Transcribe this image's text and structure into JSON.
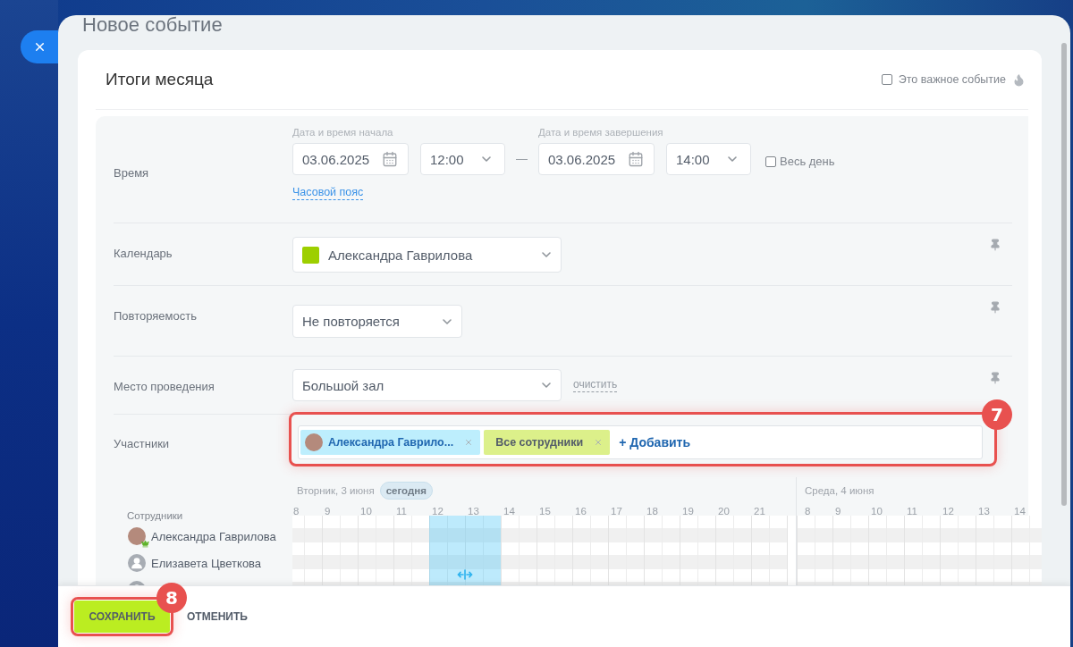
{
  "slider": {
    "title": "Новое событие"
  },
  "event": {
    "name": "Итоги месяца",
    "important": {
      "label": "Это важное событие",
      "checked": false
    }
  },
  "time": {
    "label": "Время",
    "start": {
      "caption": "Дата и время начала",
      "date": "03.06.2025",
      "time": "12:00"
    },
    "separator": "—",
    "end": {
      "caption": "Дата и время завершения",
      "date": "03.06.2025",
      "time": "14:00"
    },
    "all_day": {
      "label": "Весь день",
      "checked": false
    },
    "timezone_link": "Часовой пояс"
  },
  "fields": [
    {
      "kind": "calendar",
      "label": "Календарь",
      "value": "Александра Гаврилова",
      "color": "#9dcf00"
    },
    {
      "kind": "repeat",
      "label": "Повторяемость",
      "value": "Не повторяется"
    },
    {
      "kind": "location",
      "label": "Место проведения",
      "value": "Большой зал",
      "clear_link": "очистить"
    }
  ],
  "participants": {
    "label": "Участники",
    "callout": "7",
    "tags": [
      {
        "kind": "user",
        "name": "Александра Гаврило..."
      },
      {
        "kind": "group",
        "name": "Все сотрудники"
      }
    ],
    "add_link": "+ Добавить"
  },
  "planner": {
    "people_header": "Сотрудники",
    "people": [
      {
        "kind": "photo",
        "name": "Александра Гаврилова",
        "owner": true
      },
      {
        "kind": "default",
        "name": "Елизавета Цветкова",
        "owner": false
      },
      {
        "kind": "default",
        "owner": false
      }
    ],
    "days": [
      {
        "title": "Вторник, 3 июня",
        "today_badge": "сегодня",
        "hours": [
          {
            "label": "8",
            "selected": false
          },
          {
            "label": "9",
            "selected": false
          },
          {
            "label": "10",
            "selected": false
          },
          {
            "label": "11",
            "selected": false
          },
          {
            "label": "12",
            "selected": true
          },
          {
            "label": "13",
            "selected": true
          },
          {
            "label": "14",
            "selected": false
          },
          {
            "label": "15",
            "selected": false
          },
          {
            "label": "16",
            "selected": false
          },
          {
            "label": "17",
            "selected": false
          },
          {
            "label": "18",
            "selected": false
          },
          {
            "label": "19",
            "selected": false
          },
          {
            "label": "20",
            "selected": false
          },
          {
            "label": "21",
            "selected": false
          }
        ]
      },
      {
        "title": "Среда, 4 июня",
        "hours": [
          {
            "label": "8",
            "selected": false
          },
          {
            "label": "9",
            "selected": false
          },
          {
            "label": "10",
            "selected": false
          },
          {
            "label": "11",
            "selected": false
          },
          {
            "label": "12",
            "selected": false
          },
          {
            "label": "13",
            "selected": false
          },
          {
            "label": "14",
            "selected": false
          }
        ]
      }
    ]
  },
  "footer": {
    "buttons": [
      {
        "kind": "primary",
        "label": "СОХРАНИТЬ",
        "callout": "8"
      },
      {
        "kind": "link",
        "label": "ОТМЕНИТЬ"
      }
    ]
  }
}
